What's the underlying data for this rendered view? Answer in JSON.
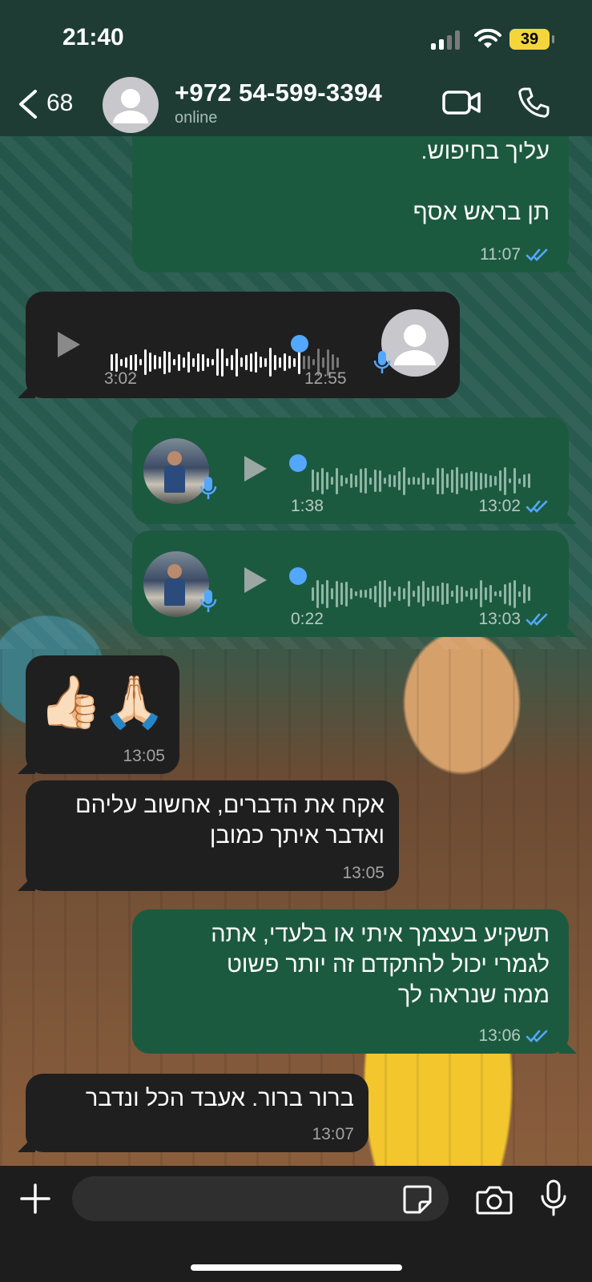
{
  "status_bar": {
    "time": "21:40",
    "battery": "39"
  },
  "header": {
    "back_count": "68",
    "contact_name": "+972 54-599-3394",
    "contact_status": "online"
  },
  "messages": [
    {
      "id": "m1",
      "type": "text",
      "direction": "out",
      "lines": [
        "עליך בחיפוש.",
        "",
        "תן בראש אסף"
      ],
      "time": "11:07",
      "read": true
    },
    {
      "id": "m2",
      "type": "voice",
      "direction": "in",
      "duration": "3:02",
      "time": "12:55"
    },
    {
      "id": "m3",
      "type": "voice",
      "direction": "out",
      "duration": "1:38",
      "time": "13:02",
      "read": true
    },
    {
      "id": "m4",
      "type": "voice",
      "direction": "out",
      "duration": "0:22",
      "time": "13:03",
      "read": true
    },
    {
      "id": "m5",
      "type": "emoji",
      "direction": "in",
      "text": "👍🏻🙏🏻",
      "time": "13:05"
    },
    {
      "id": "m6",
      "type": "text",
      "direction": "in",
      "lines": [
        "אקח את הדברים, אחשוב עליהם",
        "ואדבר איתך כמובן"
      ],
      "time": "13:05"
    },
    {
      "id": "m7",
      "type": "text",
      "direction": "out",
      "lines": [
        "תשקיע בעצמך איתי או בלעדי, אתה",
        "לגמרי יכול להתקדם זה יותר פשוט",
        "ממה שנראה לך"
      ],
      "time": "13:06",
      "read": true
    },
    {
      "id": "m8",
      "type": "text",
      "direction": "in",
      "lines": [
        "ברור ברור. אעבד הכל ונדבר"
      ],
      "time": "13:07"
    }
  ],
  "colors": {
    "outgoing_bubble": "#1c5a40",
    "incoming_bubble": "#1f1f1f",
    "read_ticks": "#53a7ff",
    "header_bg": "#1e3c33"
  },
  "icons": [
    "chevron-left-icon",
    "video-call-icon",
    "phone-icon",
    "plus-icon",
    "sticker-icon",
    "camera-icon",
    "microphone-icon",
    "play-icon",
    "double-check-icon"
  ]
}
